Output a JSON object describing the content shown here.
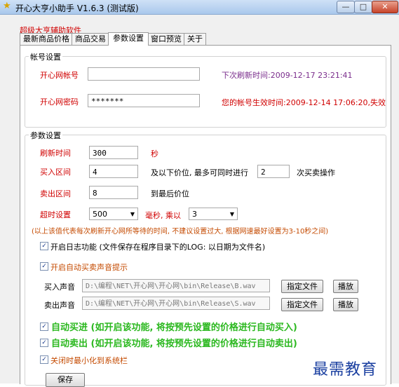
{
  "window": {
    "title": "开心大亨小助手 V1.6.3 (测试版)",
    "min": "—",
    "max": "□",
    "close": "✕"
  },
  "caption": "超级大亨辅助软件",
  "tabs": [
    "最新商品价格",
    "商品交易",
    "参数设置",
    "窗口预览",
    "关于"
  ],
  "account": {
    "group_title": "帐号设置",
    "id_label": "开心网帐号",
    "id_value": "",
    "password_label": "开心网密码",
    "password_value": "*******",
    "next_refresh": "下次刷新时间:2009-12-17 23:21:41",
    "expire": "您的帐号生效时间:2009-12-14 17:06:20,失效"
  },
  "params": {
    "group_title": "参数设置",
    "refresh_label": "刷新时间",
    "refresh_value": "300",
    "refresh_unit": "秒",
    "buy_label": "买入区间",
    "buy_value": "4",
    "buy_text": "及以下价位, 最多可同时进行",
    "buy_count": "2",
    "buy_suffix": "次买卖操作",
    "sell_label": "卖出区间",
    "sell_value": "8",
    "sell_text": "到最后价位",
    "timeout_label": "超时设置",
    "timeout_value": "500",
    "timeout_unit": "毫秒, 乘以",
    "timeout_multiplier": "3",
    "note": "(以上该值代表每次刷新开心网所等待的时间, 不建议设置过大, 根据网速最好设置为3-10秒之间)",
    "log_label": "开启日志功能 (文件保存在程序目录下的LOG: 以日期为文件名)",
    "sound_label": "开启自动买卖声音提示",
    "buy_sound_label": "买入声音",
    "buy_sound_path": "D:\\编程\\NET\\开心网\\开心网\\bin\\Release\\B.wav",
    "sell_sound_label": "卖出声音",
    "sell_sound_path": "D:\\编程\\NET\\开心网\\开心网\\bin\\Release\\S.wav",
    "choose_file": "指定文件",
    "play": "播放",
    "auto_buy": "自动买进 (如开启该功能, 将按预先设置的价格进行自动买入)",
    "auto_sell": "自动卖出 (如开启该功能, 将按预先设置的价格进行自动卖出)",
    "minimize_label": "关闭时最小化到系统栏",
    "save": "保存",
    "check": "✓"
  },
  "watermark": "最需教育",
  "icons": {
    "app": "star-icon",
    "check": "check-icon"
  }
}
